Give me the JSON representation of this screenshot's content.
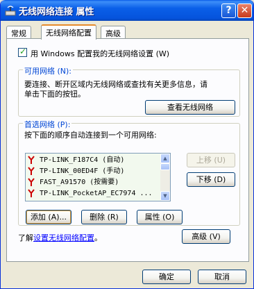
{
  "window": {
    "title": "无线网络连接 属性"
  },
  "titlebar_buttons": {
    "help": "?",
    "close": "✕"
  },
  "tabs": [
    {
      "label": "常规"
    },
    {
      "label": "无线网络配置"
    },
    {
      "label": "高级"
    }
  ],
  "config": {
    "use_windows_label": "用 Windows 配置我的无线网络设置 (W)",
    "checked": true
  },
  "available": {
    "title": "可用网络 (N):",
    "description_line1": "要连接、断开区域内无线网络或查找有关更多信息，请",
    "description_line2": "单击下面的按钮。",
    "view_button": "查看无线网络"
  },
  "preferred": {
    "title": "首选网络 (P):",
    "description": "按下面的顺序自动连接到一个可用网络:",
    "networks": [
      {
        "label": "TP-LINK_F187C4 (自动)"
      },
      {
        "label": "TP-LINK_00ED4F (手动)"
      },
      {
        "label": "FAST_A91570 (按需要)"
      },
      {
        "label": "TP-LINK_PocketAP_EC7974 ..."
      }
    ],
    "move_up": "上移 (U)",
    "move_down": "下移 (D)",
    "add": "添加 (A)...",
    "remove": "删除 (R)",
    "properties": "属性 (O)"
  },
  "learn": {
    "prefix": "了解",
    "link": "设置无线网络配置",
    "suffix": "。"
  },
  "advanced_button": "高级 (V)",
  "footer": {
    "ok": "确定",
    "cancel": "取消"
  },
  "colors": {
    "titlebar": "#0a5fe8",
    "link": "#0000ff",
    "group_title": "#0046d5",
    "list_bg": "#f2f9ee"
  }
}
